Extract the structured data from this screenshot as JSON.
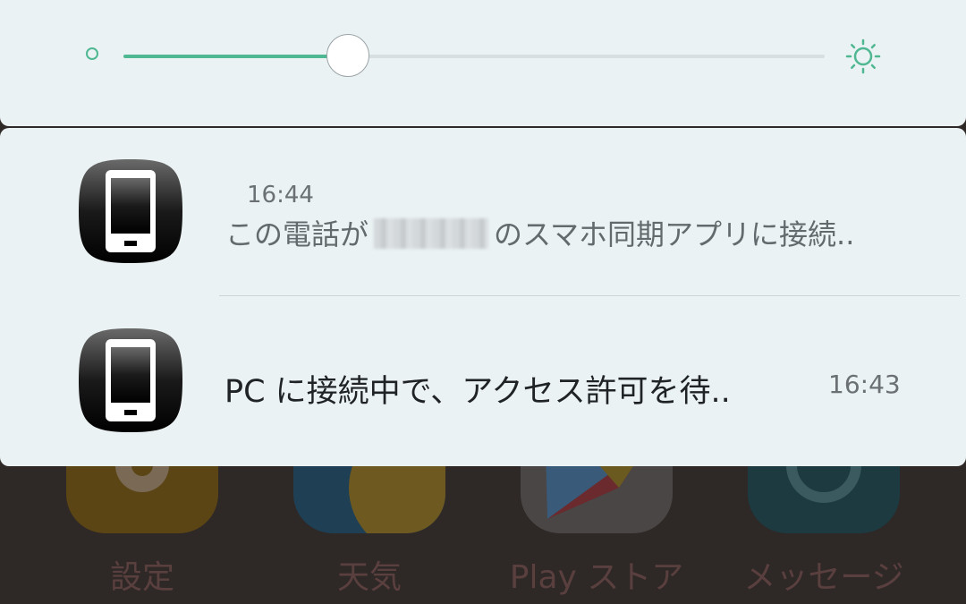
{
  "brightness": {
    "level_percent": 32,
    "dim_icon": "brightness-low-icon",
    "bright_icon": "brightness-high-icon",
    "accent_color": "#4fb892"
  },
  "notifications": [
    {
      "icon": "phone-icon",
      "time": "16:44",
      "text_before": "この電話が",
      "text_redacted": true,
      "text_after": "のスマホ同期アプリに接続.."
    },
    {
      "icon": "phone-icon",
      "time": "16:43",
      "text": "PC に接続中で、アクセス許可を待.."
    }
  ],
  "home_apps": [
    {
      "label": "設定",
      "icon": "gear-icon"
    },
    {
      "label": "天気",
      "icon": "weather-icon"
    },
    {
      "label": "Play ストア",
      "icon": "play-store-icon"
    },
    {
      "label": "メッセージ",
      "icon": "messages-icon"
    }
  ]
}
